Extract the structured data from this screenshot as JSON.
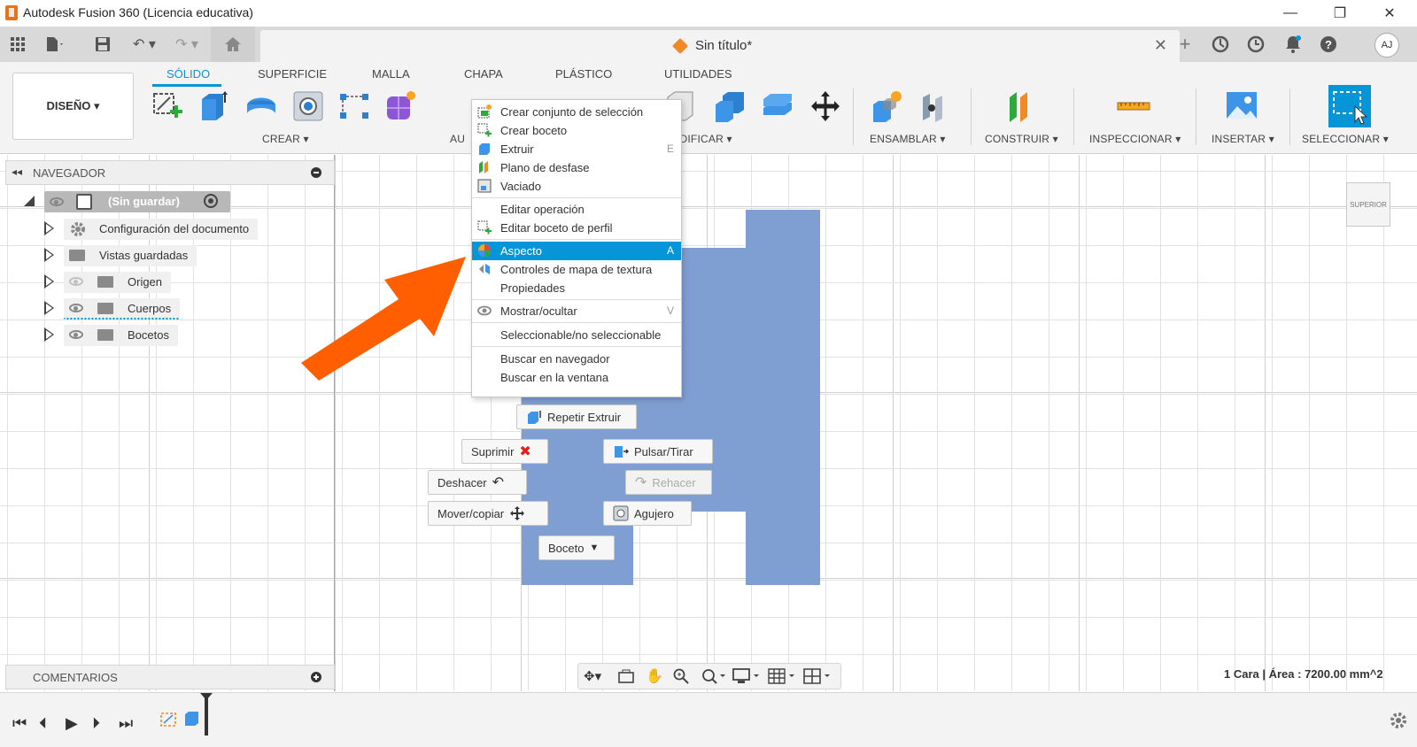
{
  "app": {
    "title": "Autodesk Fusion 360 (Licencia educativa)"
  },
  "document": {
    "tab_name": "Sin título*",
    "close_glyph": "✕"
  },
  "user": {
    "initials": "AJ"
  },
  "window_controls": {
    "minimize": "—",
    "maximize": "❐",
    "close": "✕"
  },
  "ribbon": {
    "workspace": "DISEÑO ▾",
    "tabs": [
      "SÓLIDO",
      "SUPERFICIE",
      "MALLA",
      "CHAPA",
      "PLÁSTICO",
      "UTILIDADES"
    ],
    "groups": {
      "crear": "CREAR ▾",
      "automatizar": "AU",
      "modificar": "ODIFICAR ▾",
      "ensamblar": "ENSAMBLAR ▾",
      "construir": "CONSTRUIR ▾",
      "inspeccionar": "INSPECCIONAR ▾",
      "insertar": "INSERTAR ▾",
      "seleccionar": "SELECCIONAR ▾"
    }
  },
  "navigator": {
    "title": "NAVEGADOR",
    "root": "(Sin guardar)",
    "items": [
      {
        "label": "Configuración del documento",
        "icon": "gear-icon"
      },
      {
        "label": "Vistas guardadas",
        "icon": "folder-icon"
      },
      {
        "label": "Origen",
        "icon": "folder-icon"
      },
      {
        "label": "Cuerpos",
        "icon": "folder-icon"
      },
      {
        "label": "Bocetos",
        "icon": "folder-icon"
      }
    ]
  },
  "comments": {
    "title": "COMENTARIOS"
  },
  "context_menu": {
    "items": [
      {
        "label": "Crear conjunto de selección",
        "shortcut": ""
      },
      {
        "label": "Crear boceto",
        "shortcut": ""
      },
      {
        "label": "Extruir",
        "shortcut": "E"
      },
      {
        "label": "Plano de desfase",
        "shortcut": ""
      },
      {
        "label": "Vaciado",
        "shortcut": ""
      },
      {
        "label": "Editar operación",
        "shortcut": ""
      },
      {
        "label": "Editar boceto de perfil",
        "shortcut": ""
      },
      {
        "label": "Aspecto",
        "shortcut": "A"
      },
      {
        "label": "Controles de mapa de textura",
        "shortcut": ""
      },
      {
        "label": "Propiedades",
        "shortcut": ""
      },
      {
        "label": "Mostrar/ocultar",
        "shortcut": "V"
      },
      {
        "label": "Seleccionable/no seleccionable",
        "shortcut": ""
      },
      {
        "label": "Buscar en navegador",
        "shortcut": ""
      },
      {
        "label": "Buscar en la ventana",
        "shortcut": ""
      }
    ],
    "highlighted": "Aspecto"
  },
  "marking_menu": {
    "repeat": "Repetir Extruir",
    "delete": "Suprimir",
    "press_pull": "Pulsar/Tirar",
    "undo": "Deshacer",
    "redo": "Rehacer",
    "move_copy": "Mover/copiar",
    "hole": "Agujero",
    "sketch": "Boceto"
  },
  "viewcube": {
    "face": "SUPERIOR"
  },
  "status": {
    "selection": "1 Cara | Área : 7200.00 mm^2"
  },
  "colors": {
    "accent": "#0696d7",
    "part": "#7f9fd3",
    "arrow": "#ff5f00"
  }
}
